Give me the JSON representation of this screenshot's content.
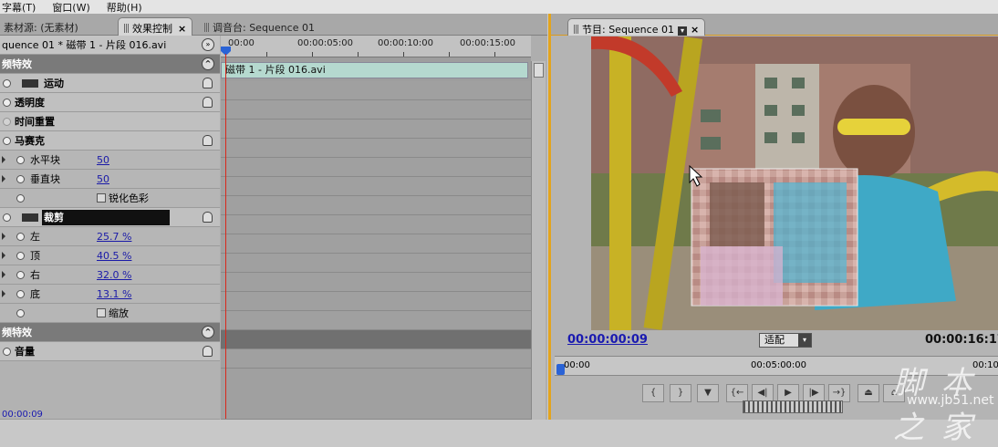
{
  "menu": [
    "字幕(T)",
    "窗口(W)",
    "帮助(H)"
  ],
  "tabs": {
    "source": "素材源: (无素材)",
    "effect_controls": "效果控制",
    "audio_mixer": "调音台: Sequence 01",
    "close": "×"
  },
  "effects": {
    "sequence_label": "quence 01 * 磁带 1 - 片段 016.avi",
    "video_header": "频特效",
    "motion": "运动",
    "opacity": "透明度",
    "time_remap": "时间重置",
    "mosaic": "马赛克",
    "mosaic_props": [
      {
        "label": "水平块",
        "value": "50"
      },
      {
        "label": "垂直块",
        "value": "50"
      }
    ],
    "sharpen": "锐化色彩",
    "crop": "裁剪",
    "crop_props": [
      {
        "label": "左",
        "value": "25.7 %"
      },
      {
        "label": "顶",
        "value": "40.5 %"
      },
      {
        "label": "右",
        "value": "32.0 %"
      },
      {
        "label": "底",
        "value": "13.1 %"
      }
    ],
    "zoom": "缩放",
    "audio_header": "频特效",
    "volume": "音量",
    "bottom_tc": "00:00:09"
  },
  "timeline": {
    "ticks": [
      "00:00",
      "00:00:05:00",
      "00:00:10:00",
      "00:00:15:00"
    ],
    "clip_name": "磁带 1 - 片段 016.avi"
  },
  "monitor": {
    "tab_label": "节目: Sequence 01",
    "current_tc": "00:00:00:09",
    "fit": "适配",
    "duration_tc": "00:00:16:17",
    "ruler": [
      "00:00",
      "00:05:00:00",
      "00:10"
    ],
    "watermark": "脚 本 之 家",
    "watermark_url": "www.jb51.net"
  },
  "colors": {
    "accent": "#e3a41d",
    "playhead": "#d8281c",
    "timecode": "#1a1ab0"
  }
}
